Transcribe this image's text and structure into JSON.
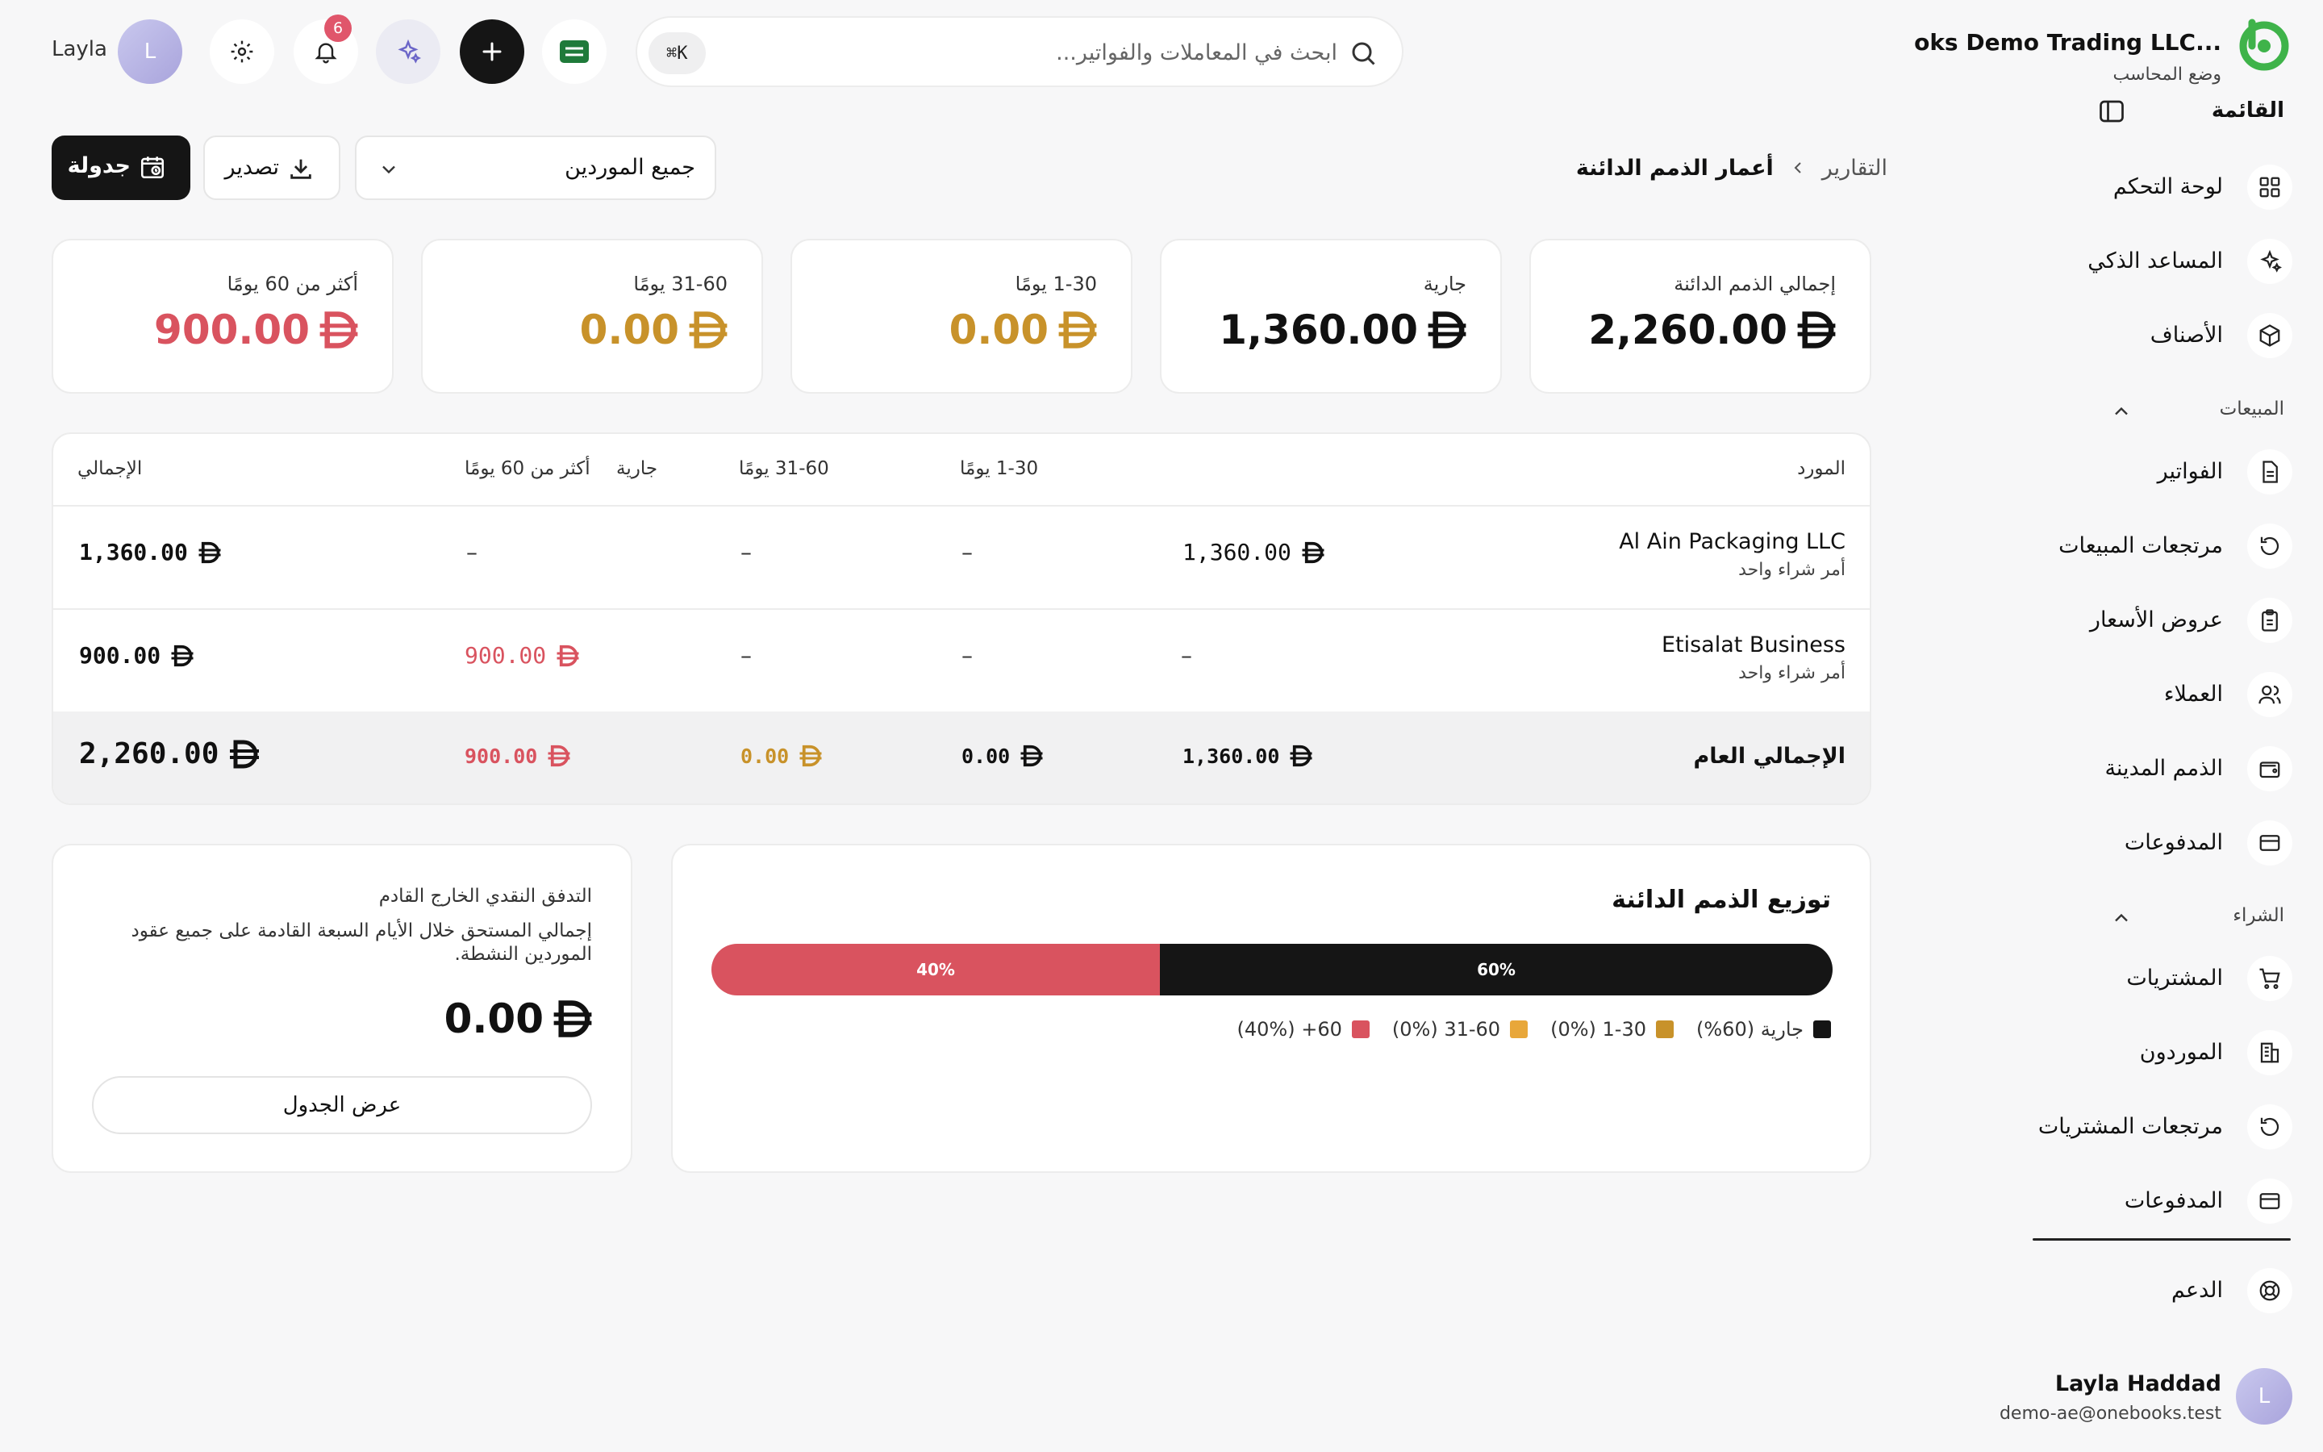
{
  "brand": {
    "name": "...oks Demo Trading LLC",
    "subtitle": "وضع المحاسب"
  },
  "sidebar": {
    "menu_title": "القائمة",
    "top_items": [
      {
        "label": "لوحة التحكم",
        "icon": "dashboard-grid-icon"
      },
      {
        "label": "المساعد الذكي",
        "icon": "sparkles-icon"
      },
      {
        "label": "الأصناف",
        "icon": "package-box-icon"
      }
    ],
    "sales_title": "المبيعات",
    "sales_items": [
      {
        "label": "الفواتير",
        "icon": "invoice-document-icon"
      },
      {
        "label": "مرتجعات المبيعات",
        "icon": "undo-circle-icon"
      },
      {
        "label": "عروض الأسعار",
        "icon": "clipboard-icon"
      },
      {
        "label": "العملاء",
        "icon": "users-icon"
      },
      {
        "label": "الذمم المدينة",
        "icon": "wallet-icon"
      },
      {
        "label": "المدفوعات",
        "icon": "credit-card-icon"
      }
    ],
    "purchase_title": "الشراء",
    "purchase_items": [
      {
        "label": "المشتريات",
        "icon": "shopping-cart-icon"
      },
      {
        "label": "الموردون",
        "icon": "building-icon"
      },
      {
        "label": "مرتجعات المشتريات",
        "icon": "undo-circle-icon"
      },
      {
        "label": "المدفوعات",
        "icon": "credit-card-icon"
      }
    ],
    "support_label": "الدعم",
    "user": {
      "initial": "L",
      "name": "Layla Haddad",
      "email": "demo-ae@onebooks.test"
    }
  },
  "topbar": {
    "search_placeholder": "ابحث في المعاملات والفواتير...",
    "shortcut": "K⌘",
    "notification_count": "6",
    "avatar_initial": "L",
    "username": "Layla"
  },
  "breadcrumb": {
    "root": "التقارير",
    "current": "أعمار الذمم الدائنة"
  },
  "filters": {
    "supplier_select": "جميع الموردين",
    "export_label": "تصدير",
    "schedule_label": "جدولة"
  },
  "summary_cards": [
    {
      "label": "إجمالي الذمم الدائنة",
      "value": "2,260.00",
      "color": "#111111"
    },
    {
      "label": "جارية",
      "value": "1,360.00",
      "color": "#111111"
    },
    {
      "label": "1-30 يومًا",
      "value": "0.00",
      "color": "#c8922a"
    },
    {
      "label": "31-60 يومًا",
      "value": "0.00",
      "color": "#c8922a"
    },
    {
      "label": "أكثر من 60 يومًا",
      "value": "900.00",
      "color": "#d9535f"
    }
  ],
  "table": {
    "headers": {
      "supplier": "المورد",
      "current": "جارية",
      "d1_30": "1-30 يومًا",
      "d31_60": "31-60 يومًا",
      "d60_plus": "أكثر من 60 يومًا",
      "total": "الإجمالي"
    },
    "rows": [
      {
        "supplier": "Al Ain Packaging LLC",
        "sub": "أمر شراء واحد",
        "current": "1,360.00",
        "d1_30": "–",
        "d31_60": "–",
        "d60_plus": "–",
        "total": "1,360.00"
      },
      {
        "supplier": "Etisalat Business",
        "sub": "أمر شراء واحد",
        "current": "–",
        "d1_30": "–",
        "d31_60": "–",
        "d60_plus": "900.00",
        "total": "900.00"
      }
    ],
    "grand_total": {
      "label": "الإجمالي العام",
      "current": "1,360.00",
      "d1_30": "0.00",
      "d31_60": "0.00",
      "d60_plus": "900.00",
      "total": "2,260.00"
    }
  },
  "distribution": {
    "title": "توزيع الذمم الدائنة",
    "segments": [
      {
        "label": "60%",
        "value": 60,
        "color": "#151515"
      },
      {
        "label": "40%",
        "value": 40,
        "color": "#d9535f"
      }
    ],
    "legend": [
      {
        "label": "جارية (60%)",
        "color": "#151515"
      },
      {
        "label": "1-30 (0%)",
        "color": "#c8922a"
      },
      {
        "label": "31-60 (0%)",
        "color": "#e8a73a"
      },
      {
        "label": "60+ (40%)",
        "color": "#d9535f"
      }
    ]
  },
  "cashflow": {
    "title": "التدفق النقدي الخارج القادم",
    "description": "إجمالي المستحق خلال الأيام السبعة القادمة على جميع عقود الموردين النشطة.",
    "value": "0.00",
    "button_label": "عرض الجدول"
  },
  "colors": {
    "accent_green": "#3fb34a",
    "overdue_red": "#d9535f",
    "aging_amber": "#c8922a",
    "dark": "#151515"
  }
}
